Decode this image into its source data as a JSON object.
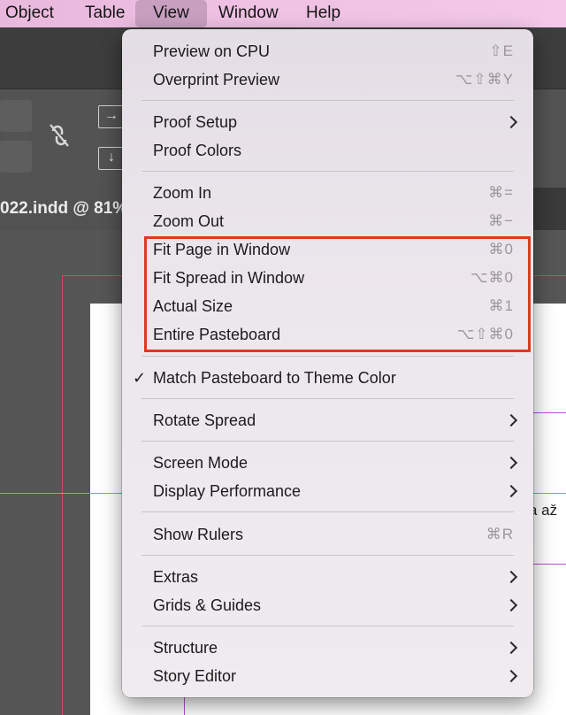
{
  "menubar": {
    "items": [
      {
        "label": "Object"
      },
      {
        "label": "Table"
      },
      {
        "label": "View"
      },
      {
        "label": "Window"
      },
      {
        "label": "Help"
      }
    ]
  },
  "document": {
    "tab_title": "022.indd @ 81%",
    "page_text": "a až"
  },
  "view_menu": {
    "items": [
      {
        "label": "Preview on CPU",
        "shortcut": "⇧E"
      },
      {
        "label": "Overprint Preview",
        "shortcut": "⌥⇧⌘Y"
      },
      {
        "label": "Proof Setup"
      },
      {
        "label": "Proof Colors"
      },
      {
        "label": "Zoom In",
        "shortcut": "⌘="
      },
      {
        "label": "Zoom Out",
        "shortcut": "⌘−"
      },
      {
        "label": "Fit Page in Window",
        "shortcut": "⌘0"
      },
      {
        "label": "Fit Spread in Window",
        "shortcut": "⌥⌘0"
      },
      {
        "label": "Actual Size",
        "shortcut": "⌘1"
      },
      {
        "label": "Entire Pasteboard",
        "shortcut": "⌥⇧⌘0"
      },
      {
        "label": "Match Pasteboard to Theme Color",
        "check": "✓"
      },
      {
        "label": "Rotate Spread"
      },
      {
        "label": "Screen Mode"
      },
      {
        "label": "Display Performance"
      },
      {
        "label": "Show Rulers",
        "shortcut": "⌘R"
      },
      {
        "label": "Extras"
      },
      {
        "label": "Grids & Guides"
      },
      {
        "label": "Structure"
      },
      {
        "label": "Story Editor"
      }
    ]
  },
  "colors": {
    "highlight_border": "#e0391f",
    "menubar_bg": "#f0c2e4",
    "menu_bg": "#ece7ed"
  }
}
